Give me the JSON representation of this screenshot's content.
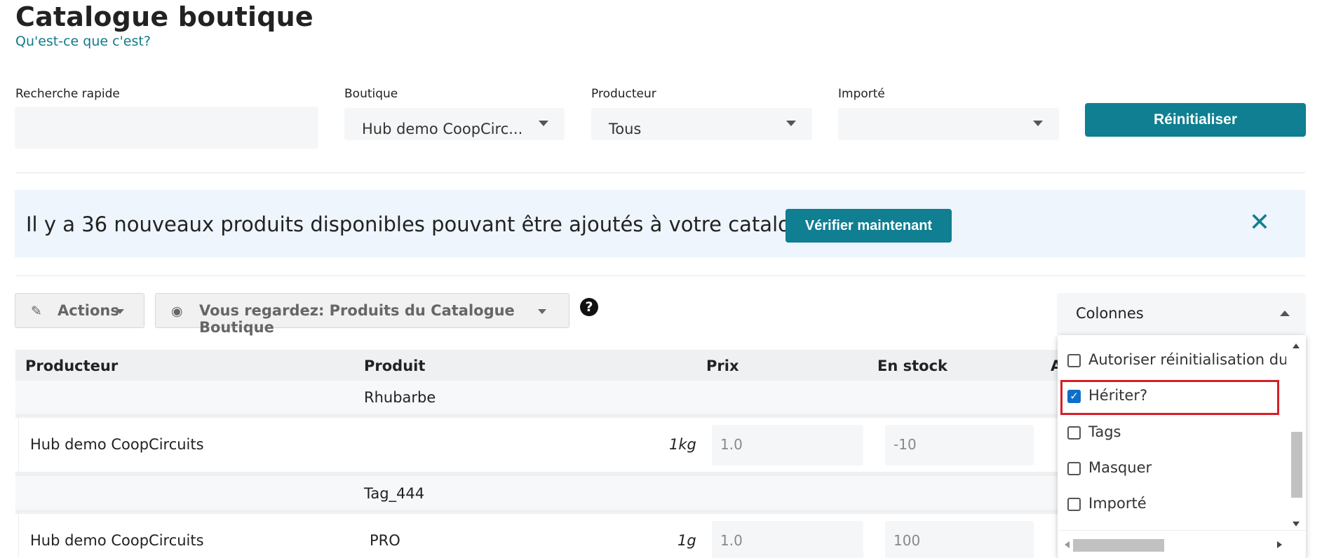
{
  "header": {
    "title": "Catalogue boutique",
    "whatis_link": "Qu'est-ce que c'est?"
  },
  "filters": {
    "quick_search": {
      "label": "Recherche rapide",
      "value": ""
    },
    "shop": {
      "label": "Boutique",
      "value": "Hub demo CoopCirc..."
    },
    "producer": {
      "label": "Producteur",
      "value": "Tous"
    },
    "imported": {
      "label": "Importé",
      "value": ""
    },
    "reset_label": "Réinitialiser"
  },
  "notice": {
    "text": "Il y a 36 nouveaux produits disponibles pouvant être ajoutés à votre catalogue.",
    "button": "Vérifier maintenant",
    "close": "✕"
  },
  "toolbar": {
    "actions_label": "Actions",
    "view_label": "Vous regardez: Produits du Catalogue Boutique",
    "help_label": "?"
  },
  "columns_menu": {
    "toggle_label": "Colonnes",
    "options": [
      {
        "label": "Autoriser réinitialisation du s",
        "checked": false
      },
      {
        "label": "Hériter?",
        "checked": true
      },
      {
        "label": "Tags",
        "checked": false
      },
      {
        "label": "Masquer",
        "checked": false
      },
      {
        "label": "Importé",
        "checked": false
      }
    ]
  },
  "table": {
    "headers": [
      "Producteur",
      "Produit",
      "Prix",
      "En stock",
      "A"
    ],
    "rows": [
      {
        "type": "product",
        "product": "Rhubarbe"
      },
      {
        "type": "variant",
        "producer": "Hub demo CoopCircuits",
        "unit": "1kg",
        "price": "1.0",
        "stock": "-10"
      },
      {
        "type": "product",
        "product": "Tag_444"
      },
      {
        "type": "variant",
        "producer": "Hub demo CoopCircuits",
        "product": "PRO",
        "unit": "1g",
        "price": "1.0",
        "stock": "100"
      }
    ]
  }
}
